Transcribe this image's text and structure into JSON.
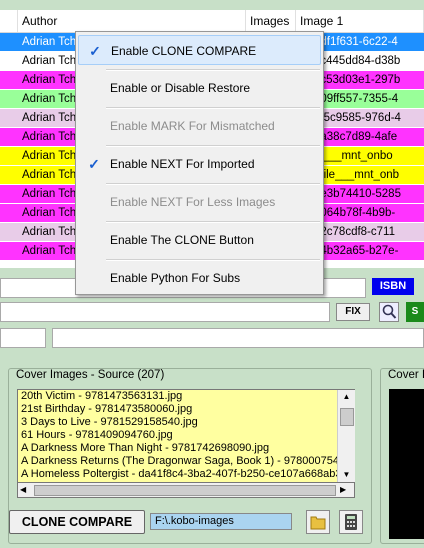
{
  "grid": {
    "columns": {
      "author": "Author",
      "images": "Images",
      "image1": "Image 1"
    },
    "rows": [
      {
        "author": "Adrian Tch",
        "image1": "31\\adf1f631-6c22-4",
        "bg": "#1e90ff",
        "fg": "#ffffff"
      },
      {
        "author": "Adrian Tch",
        "image1": "123\\c445dd84-d38b",
        "bg": "#ffffff",
        "fg": "#000000"
      },
      {
        "author": "Adrian Tch",
        "image1": "204\\c53d03e1-297b",
        "bg": "#ff33ff",
        "fg": "#000000"
      },
      {
        "author": "Adrian Tch",
        "image1": "20\\a09ff557-7355-4",
        "bg": "#99ff99",
        "fg": "#000000"
      },
      {
        "author": "Adrian Tch",
        "image1": "89\\2f5c9585-976d-4",
        "bg": "#e8cce8",
        "fg": "#000000"
      },
      {
        "author": "Adrian Tch",
        "image1": "202\\a38c7d89-4afe",
        "bg": "#ff33ff",
        "fg": "#000000"
      },
      {
        "author": "Adrian Tch",
        "image1": "3\\file___mnt_onbo",
        "bg": "#ffff00",
        "fg": "#000000"
      },
      {
        "author": "Adrian Tch",
        "image1": "212\\file___mnt_onb",
        "bg": "#ffff00",
        "fg": "#000000"
      },
      {
        "author": "Adrian Tch",
        "image1": "243\\e3b74410-5285",
        "bg": "#ff33ff",
        "fg": "#000000"
      },
      {
        "author": "Adrian Tch",
        "image1": "46\\3064b78f-4b9b-",
        "bg": "#ff33ff",
        "fg": "#000000"
      },
      {
        "author": "Adrian Tch",
        "image1": "242\\2c78cdf8-c711",
        "bg": "#e8cce8",
        "fg": "#000000"
      },
      {
        "author": "Adrian Tch",
        "image1": "20\\64b32a65-b27e-",
        "bg": "#ff33ff",
        "fg": "#000000"
      }
    ]
  },
  "context_menu": {
    "items": [
      {
        "label": "Enable CLONE COMPARE",
        "checked": true,
        "enabled": true,
        "highlight": true
      },
      {
        "label": "Enable or Disable Restore",
        "checked": false,
        "enabled": true,
        "highlight": false
      },
      {
        "label": "Enable MARK For Mismatched",
        "checked": false,
        "enabled": false,
        "highlight": false
      },
      {
        "label": "Enable NEXT For Imported",
        "checked": true,
        "enabled": true,
        "highlight": false
      },
      {
        "label": "Enable NEXT For Less Images",
        "checked": false,
        "enabled": false,
        "highlight": false
      },
      {
        "label": "Enable The CLONE Button",
        "checked": false,
        "enabled": true,
        "highlight": false
      },
      {
        "label": "Enable Python For Subs",
        "checked": false,
        "enabled": true,
        "highlight": false
      }
    ],
    "check_glyph": "✓"
  },
  "isbn_label": "ISBN",
  "fix_label": "FIX",
  "green_label": "S",
  "cover_source": {
    "title": "Cover Images - Source (207)",
    "items": [
      "20th Victim - 9781473563131.jpg",
      "21st Birthday - 9781473580060.jpg",
      "3 Days to Live - 9781529158540.jpg",
      "61 Hours - 9781409094760.jpg",
      "A Darkness More Than Night - 9781742698090.jpg",
      "A Darkness Returns (The Dragonwar Saga, Book 1) - 9780007541",
      "A Homeless Poltergist - da41f8c4-3ba2-407f-b250-ce107a668ab3.jp"
    ]
  },
  "cover_target_title": "Cover In",
  "clone_compare_label": "CLONE COMPARE",
  "path_value": "F:\\.kobo-images",
  "icons": {
    "folder": "folder-icon",
    "calculator": "calculator-icon",
    "search": "search-icon"
  }
}
